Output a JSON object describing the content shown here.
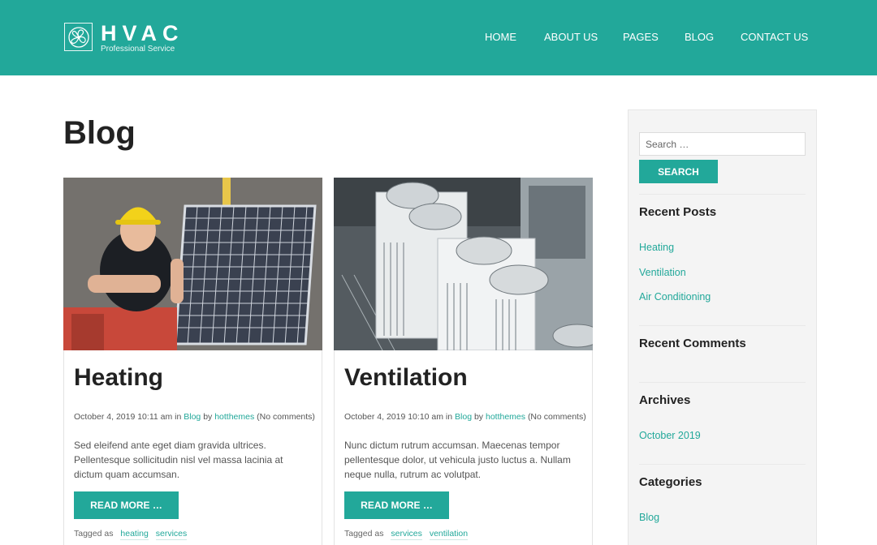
{
  "brand": {
    "name": "HVAC",
    "tagline": "Professional Service"
  },
  "nav": {
    "items": [
      "HOME",
      "ABOUT US",
      "PAGES",
      "BLOG",
      "CONTACT US"
    ]
  },
  "page": {
    "title": "Blog"
  },
  "posts": [
    {
      "title": "Heating",
      "date": "October 4, 2019 10:11 am",
      "in_word": "in",
      "category": "Blog",
      "by_word": "by",
      "author": "hotthemes",
      "comments": "(No comments)",
      "excerpt": "Sed eleifend ante eget diam gravida ultrices. Pellentesque sollicitudin nisl vel massa lacinia at dictum quam accumsan.",
      "read_more": "READ MORE …",
      "tagged_label": "Tagged as",
      "tags": [
        "heating",
        "services"
      ]
    },
    {
      "title": "Ventilation",
      "date": "October 4, 2019 10:10 am",
      "in_word": "in",
      "category": "Blog",
      "by_word": "by",
      "author": "hotthemes",
      "comments": "(No comments)",
      "excerpt": "Nunc dictum rutrum accumsan. Maecenas tempor pellentesque dolor, ut vehicula justo luctus a. Nullam neque nulla, rutrum ac volutpat.",
      "read_more": "READ MORE …",
      "tagged_label": "Tagged as",
      "tags": [
        "services",
        "ventilation"
      ]
    }
  ],
  "sidebar": {
    "search_placeholder": "Search …",
    "search_button": "SEARCH",
    "recent_posts_title": "Recent Posts",
    "recent_posts": [
      "Heating",
      "Ventilation",
      "Air Conditioning"
    ],
    "recent_comments_title": "Recent Comments",
    "archives_title": "Archives",
    "archives": [
      "October 2019"
    ],
    "categories_title": "Categories",
    "categories": [
      "Blog"
    ]
  },
  "colors": {
    "accent": "#22a89a",
    "header_bg": "#22a89a",
    "sidebar_bg": "#f4f4f4"
  },
  "icons": {
    "logo": "fan-logo-icon"
  }
}
